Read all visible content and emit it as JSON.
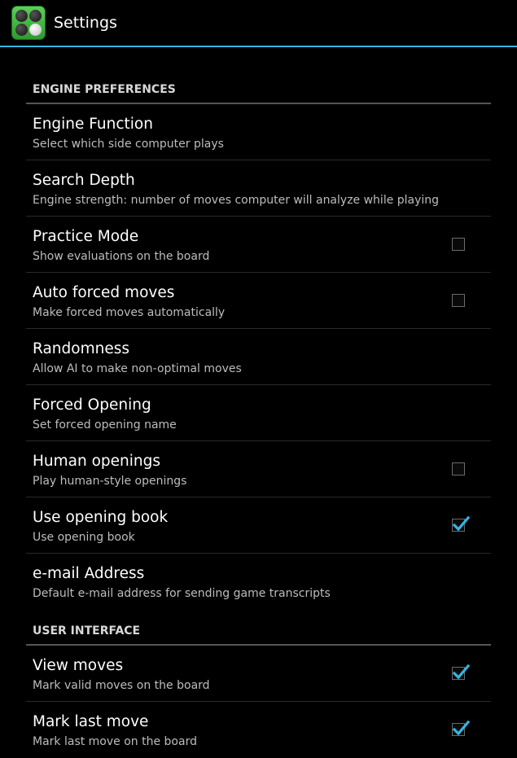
{
  "app": {
    "title": "Settings",
    "icon": "reversi-board-icon"
  },
  "colors": {
    "accent": "#33b5e5",
    "background": "#000000",
    "title_text": "#ffffff",
    "summary_text": "#bdbdbd"
  },
  "categories": [
    {
      "title": "ENGINE PREFERENCES",
      "items": [
        {
          "title": "Engine Function",
          "summary": "Select which side computer plays",
          "checkbox": null
        },
        {
          "title": "Search Depth",
          "summary": "Engine strength: number of moves computer will analyze while playing",
          "checkbox": null
        },
        {
          "title": "Practice Mode",
          "summary": "Show evaluations on the board",
          "checkbox": false
        },
        {
          "title": "Auto forced moves",
          "summary": "Make forced moves automatically",
          "checkbox": false
        },
        {
          "title": "Randomness",
          "summary": "Allow AI to make non-optimal moves",
          "checkbox": null
        },
        {
          "title": "Forced Opening",
          "summary": "Set forced opening name",
          "checkbox": null
        },
        {
          "title": "Human openings",
          "summary": "Play human-style openings",
          "checkbox": false
        },
        {
          "title": "Use opening book",
          "summary": "Use opening book",
          "checkbox": true
        },
        {
          "title": "e-mail Address",
          "summary": "Default e-mail address for sending game transcripts",
          "checkbox": null
        }
      ]
    },
    {
      "title": "USER INTERFACE",
      "items": [
        {
          "title": "View moves",
          "summary": "Mark valid moves on the board",
          "checkbox": true
        },
        {
          "title": "Mark last move",
          "summary": "Mark last move on the board",
          "checkbox": true
        }
      ]
    }
  ]
}
